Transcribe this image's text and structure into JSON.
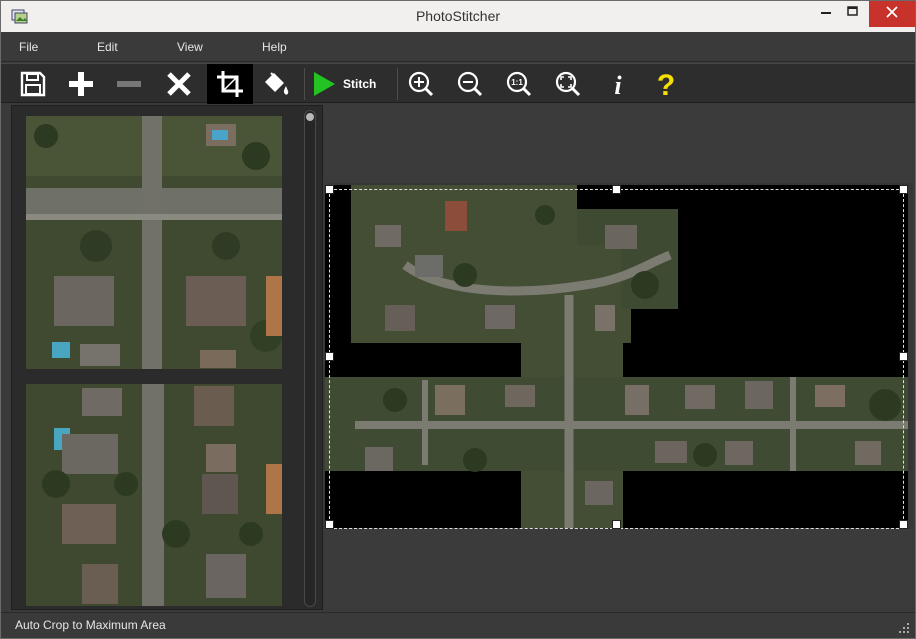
{
  "window": {
    "title": "PhotoStitcher"
  },
  "window_controls": {
    "minimize": "—",
    "maximize": "☐",
    "close": "✕"
  },
  "menu": [
    "File",
    "Edit",
    "View",
    "Help"
  ],
  "toolbar": {
    "buttons": [
      {
        "name": "save",
        "icon": "save-icon",
        "enabled": true
      },
      {
        "name": "add",
        "icon": "plus-icon",
        "enabled": true
      },
      {
        "name": "remove",
        "icon": "minus-icon",
        "enabled": false
      },
      {
        "name": "delete",
        "icon": "close-x-icon",
        "enabled": true
      },
      {
        "name": "crop",
        "icon": "crop-icon",
        "active": true
      },
      {
        "name": "fill",
        "icon": "paint-bucket-icon",
        "enabled": true
      },
      {
        "name": "zoom-in",
        "icon": "zoom-in-icon"
      },
      {
        "name": "zoom-out",
        "icon": "zoom-out-icon"
      },
      {
        "name": "zoom-actual",
        "icon": "zoom-1-1-icon",
        "label": "1:1"
      },
      {
        "name": "zoom-fit",
        "icon": "zoom-fit-icon"
      },
      {
        "name": "info",
        "icon": "info-icon",
        "label": "i"
      },
      {
        "name": "help",
        "icon": "help-icon",
        "label": "?"
      }
    ],
    "stitch_label": "Stitch"
  },
  "status": {
    "text": "Auto Crop to Maximum Area"
  },
  "colors": {
    "help": "#f5e000",
    "stitch": "#22c322",
    "close": "#c7332b",
    "panel": "#2b2b2b"
  }
}
